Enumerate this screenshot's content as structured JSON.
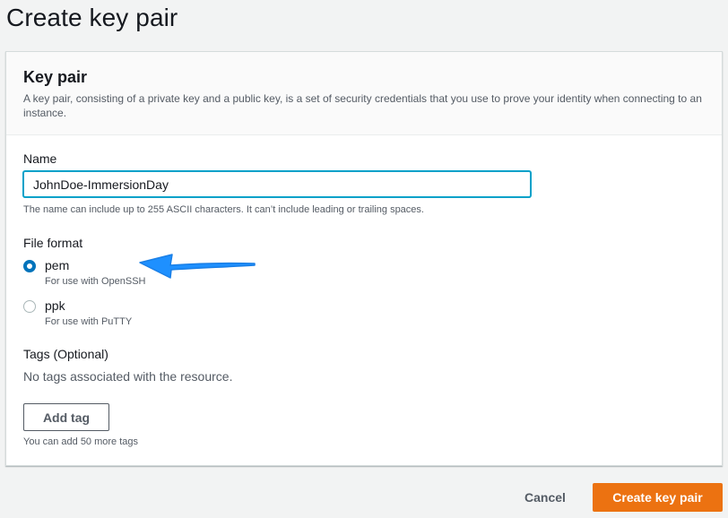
{
  "page": {
    "title": "Create key pair"
  },
  "key_pair_panel": {
    "title": "Key pair",
    "description": "A key pair, consisting of a private key and a public key, is a set of security credentials that you use to prove your identity when connecting to an instance."
  },
  "name_field": {
    "label": "Name",
    "value": "JohnDoe-ImmersionDay",
    "hint": "The name can include up to 255 ASCII characters. It can’t include leading or trailing spaces."
  },
  "file_format": {
    "label": "File format",
    "options": [
      {
        "label": "pem",
        "description": "For use with OpenSSH",
        "selected": true
      },
      {
        "label": "ppk",
        "description": "For use with PuTTY",
        "selected": false
      }
    ]
  },
  "tags": {
    "label": "Tags (Optional)",
    "empty_text": "No tags associated with the resource.",
    "add_button_label": "Add tag",
    "hint": "You can add 50 more tags"
  },
  "footer": {
    "cancel_label": "Cancel",
    "create_label": "Create key pair"
  },
  "colors": {
    "primary_button": "#ec7211",
    "radio_selected": "#0073bb",
    "input_focus": "#00a1c9",
    "annotation_arrow": "#1e90ff"
  },
  "annotation": {
    "icon": "arrow-left-icon"
  }
}
